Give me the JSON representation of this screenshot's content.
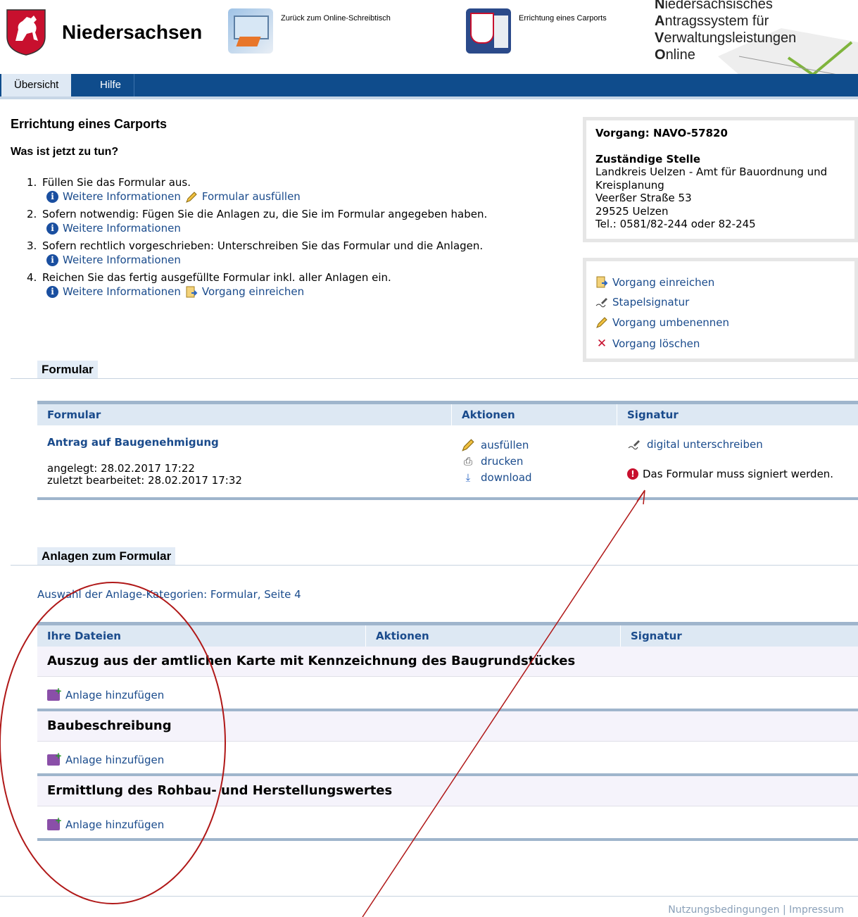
{
  "header": {
    "brand": "Niedersachsen",
    "back_label": "Zurück zum Online-Schreibtisch",
    "process_label": "Errichtung eines Carports",
    "navo_lines": [
      {
        "first": "N",
        "rest": "iedersächsisches"
      },
      {
        "first": "A",
        "rest": "ntragssystem für"
      },
      {
        "first": "V",
        "rest": "erwaltungsleistungen"
      },
      {
        "first": "O",
        "rest": "nline"
      }
    ]
  },
  "nav": {
    "tabs": [
      "Übersicht",
      "Hilfe"
    ],
    "active": "Übersicht"
  },
  "page": {
    "title": "Errichtung eines Carports",
    "subtitle": "Was ist jetzt zu tun?"
  },
  "steps": [
    {
      "num": "1.",
      "text": "Füllen Sie das Formular aus.",
      "info": "Weitere Informationen",
      "action": "Formular ausfüllen"
    },
    {
      "num": "2.",
      "text": "Sofern notwendig: Fügen Sie die Anlagen zu, die Sie im Formular angegeben haben.",
      "info": "Weitere Informationen"
    },
    {
      "num": "3.",
      "text": "Sofern rechtlich vorgeschrieben: Unterschreiben Sie das Formular und die Anlagen.",
      "info": "Weitere Informationen"
    },
    {
      "num": "4.",
      "text": "Reichen Sie das fertig ausgefüllte Formular inkl. aller Anlagen ein.",
      "info": "Weitere Informationen",
      "action": "Vorgang einreichen"
    }
  ],
  "vorgang": {
    "id_label": "Vorgang: NAVO-57820",
    "office_heading": "Zuständige Stelle",
    "office_lines": [
      "Landkreis Uelzen - Amt für Bauordnung und",
      "Kreisplanung",
      "Veerßer Straße 53",
      "29525 Uelzen",
      "Tel.: 0581/82-244 oder 82-245"
    ]
  },
  "actions": [
    "Vorgang einreichen",
    "Stapelsignatur",
    "Vorgang umbenennen",
    "Vorgang löschen"
  ],
  "formular_section": {
    "title": "Formular",
    "headers": [
      "Formular",
      "Aktionen",
      "Signatur"
    ],
    "form_name": "Antrag auf Baugenehmigung",
    "created": "angelegt: 28.02.2017 17:22",
    "edited": "zuletzt bearbeitet: 28.02.2017 17:32",
    "row_actions": [
      "ausfüllen",
      "drucken",
      "download"
    ],
    "sign_link": "digital unterschreiben",
    "sign_warning": "Das Formular muss signiert werden."
  },
  "anlagen_section": {
    "title": "Anlagen zum Formular",
    "category_link": "Auswahl der Anlage-Kategorien: Formular, Seite 4",
    "headers": [
      "Ihre Dateien",
      "Aktionen",
      "Signatur"
    ],
    "groups": [
      {
        "name": "Auszug aus der amtlichen Karte mit Kennzeichnung des Baugrundstückes",
        "add": "Anlage hinzufügen"
      },
      {
        "name": "Baubeschreibung",
        "add": "Anlage hinzufügen"
      },
      {
        "name": "Ermittlung des Rohbau- und Herstellungswertes",
        "add": "Anlage hinzufügen"
      }
    ]
  },
  "footer": {
    "links": [
      "Nutzungsbedingungen",
      "Impressum"
    ],
    "separator": "|"
  },
  "colors": {
    "nav_blue": "#0f4c8c",
    "link": "#1a4b8c",
    "annotation_red": "#b01818"
  }
}
